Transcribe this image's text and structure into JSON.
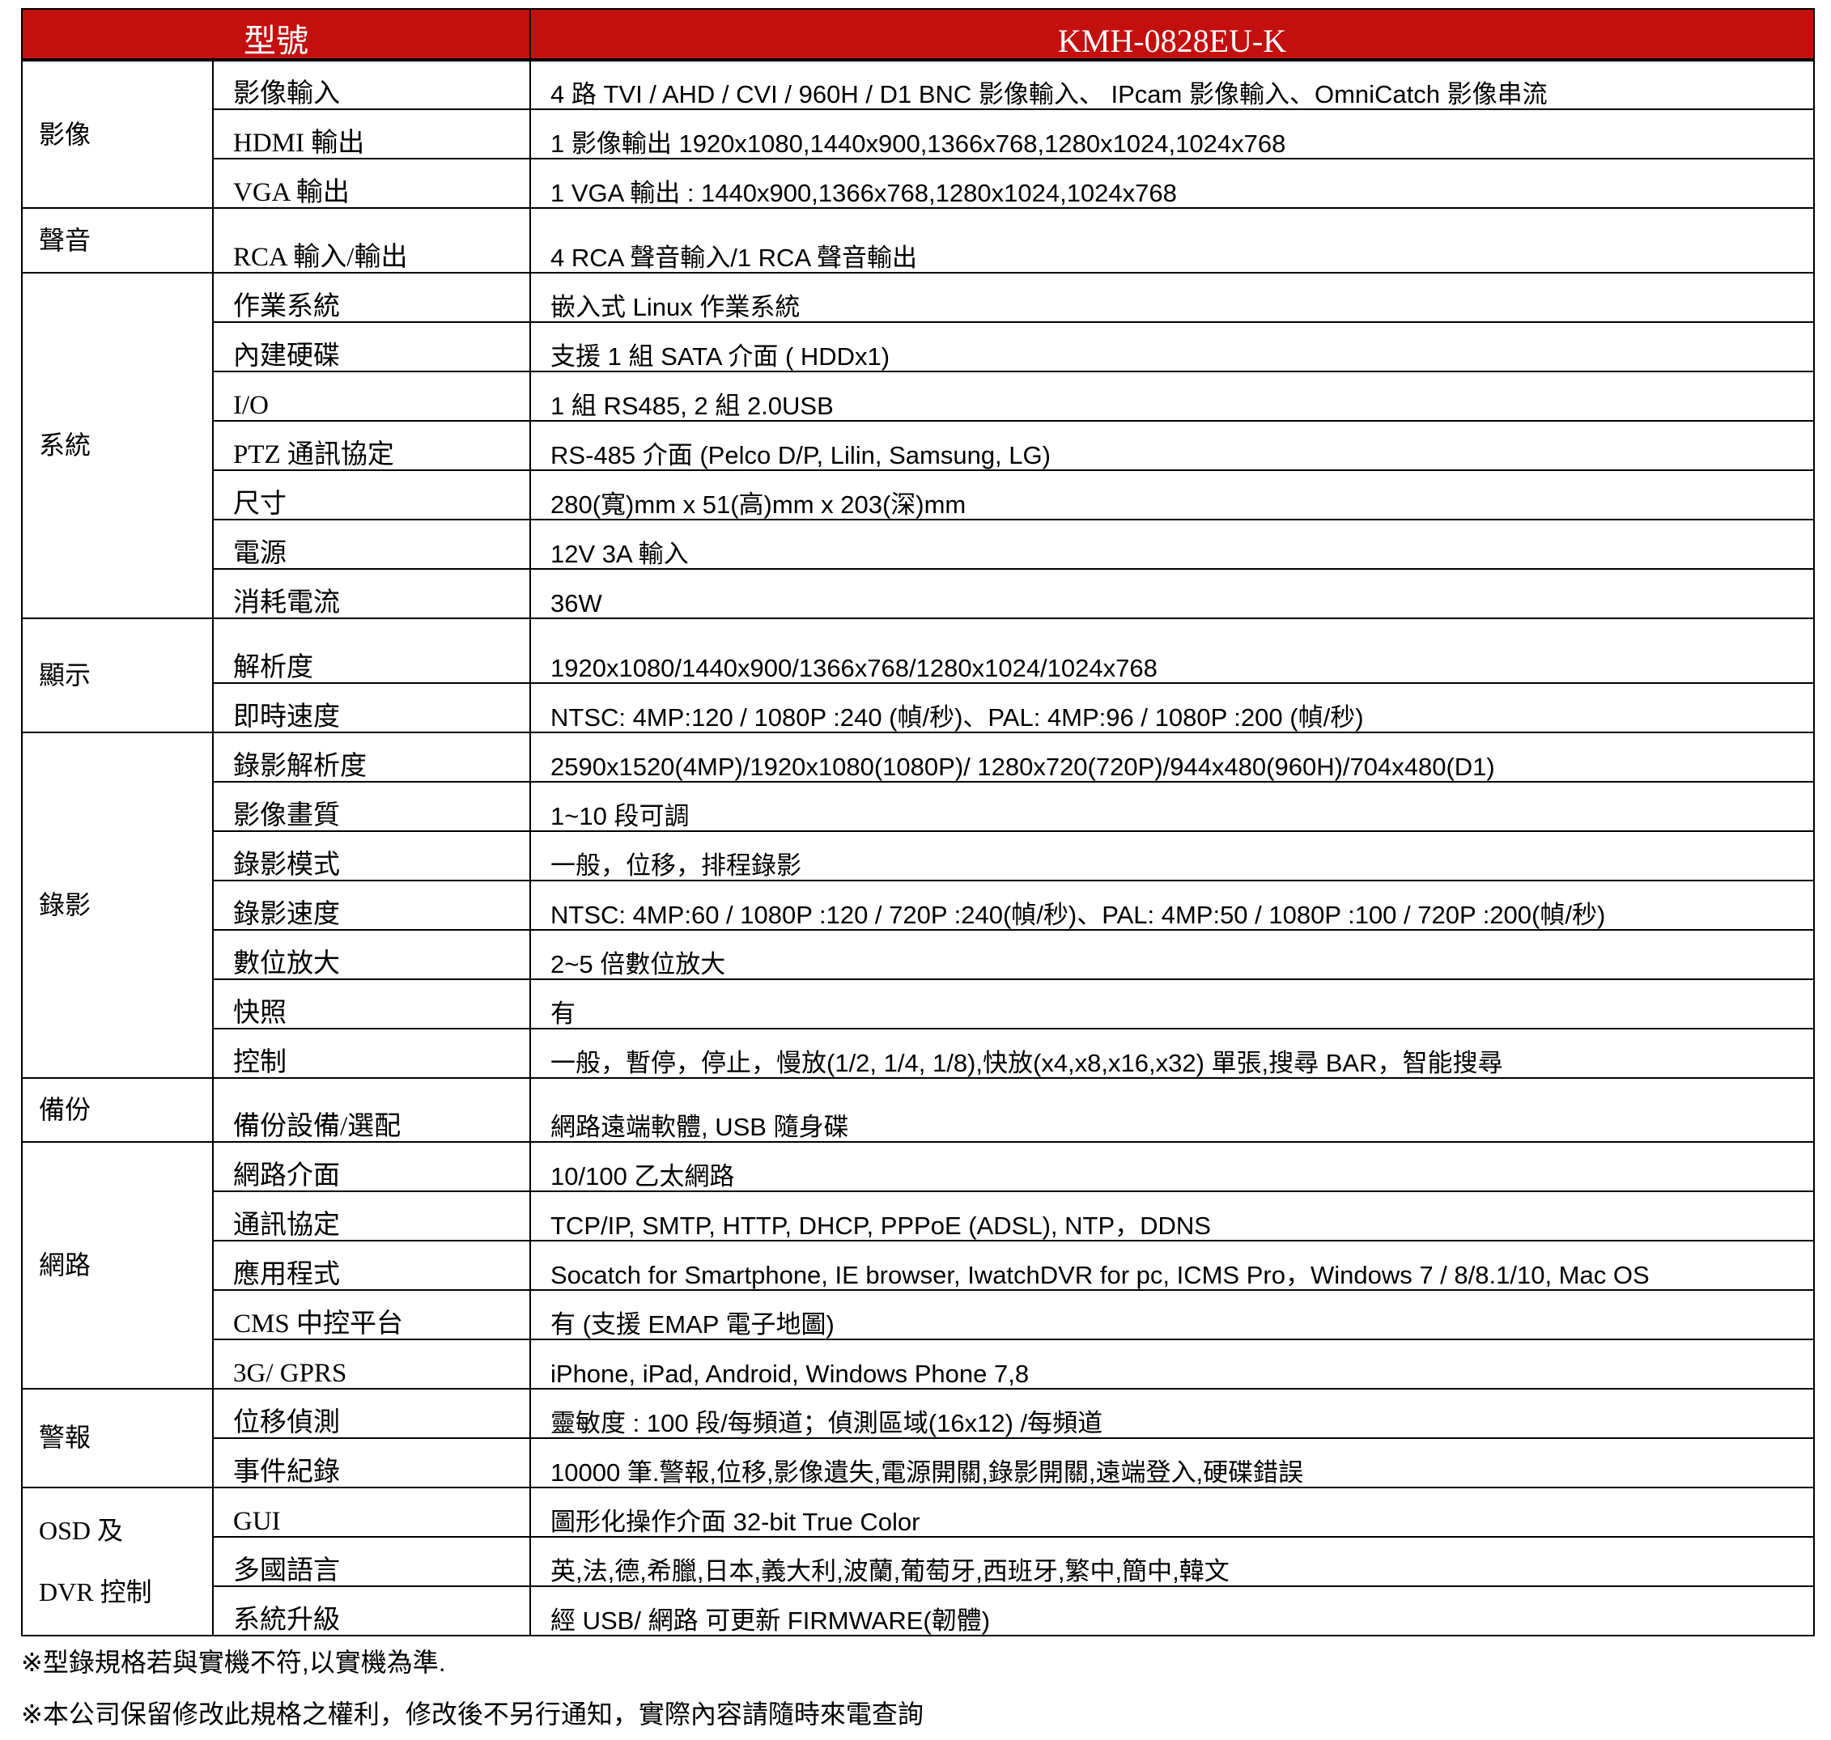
{
  "header": {
    "col1": "型號",
    "col2": "KMH-0828EU-K"
  },
  "groups": [
    {
      "category": [
        "影像"
      ],
      "rows": [
        {
          "feature": "影像輸入",
          "value": "4 路 TVI / AHD / CVI / 960H / D1 BNC 影像輸入、 IPcam 影像輸入、OmniCatch 影像串流"
        },
        {
          "feature": "HDMI 輸出",
          "value": "1 影像輸出 1920x1080,1440x900,1366x768,1280x1024,1024x768"
        },
        {
          "feature": "VGA 輸出",
          "value": "1 VGA  輸出 : 1440x900,1366x768,1280x1024,1024x768"
        }
      ]
    },
    {
      "category": [
        "聲音"
      ],
      "rows": [
        {
          "feature": "RCA 輸入/輸出",
          "value": "4 RCA 聲音輸入/1 RCA  聲音輸出",
          "tall": true
        }
      ]
    },
    {
      "category": [
        "系統"
      ],
      "rows": [
        {
          "feature": "作業系統",
          "value": "嵌入式 Linux  作業系統"
        },
        {
          "feature": "內建硬碟",
          "value": "支援 1 組  SATA 介面  ( HDDx1)"
        },
        {
          "feature": "I/O",
          "value": "1 組 RS485, 2 組 2.0USB"
        },
        {
          "feature": "PTZ 通訊協定",
          "value": "RS-485 介面  (Pelco D/P, Lilin, Samsung, LG)"
        },
        {
          "feature": "尺寸",
          "value": "280(寬)mm x 51(高)mm x 203(深)mm"
        },
        {
          "feature": "電源",
          "value": "12V 3A  輸入"
        },
        {
          "feature": "消耗電流",
          "value": "36W"
        }
      ]
    },
    {
      "category": [
        "顯示"
      ],
      "rows": [
        {
          "feature": "解析度",
          "value": "1920x1080/1440x900/1366x768/1280x1024/1024x768",
          "tall": true
        },
        {
          "feature": "即時速度",
          "value": "NTSC: 4MP:120 / 1080P :240 (幀/秒)、PAL: 4MP:96 / 1080P :200 (幀/秒)"
        }
      ]
    },
    {
      "category": [
        "錄影"
      ],
      "rows": [
        {
          "feature": "錄影解析度",
          "value": "2590x1520(4MP)/1920x1080(1080P)/ 1280x720(720P)/944x480(960H)/704x480(D1)"
        },
        {
          "feature": "影像畫質",
          "value": "1~10 段可調"
        },
        {
          "feature": "錄影模式",
          "value": "一般，位移，排程錄影"
        },
        {
          "feature": "錄影速度",
          "value": "NTSC: 4MP:60 / 1080P :120 / 720P :240(幀/秒)、PAL: 4MP:50 / 1080P :100 / 720P :200(幀/秒)"
        },
        {
          "feature": "數位放大",
          "value": "2~5 倍數位放大"
        },
        {
          "feature": "快照",
          "value": "有"
        },
        {
          "feature": "控制",
          "value": "一般，暫停，停止，慢放(1/2, 1/4, 1/8),快放(x4,x8,x16,x32)  單張,搜尋 BAR，智能搜尋"
        }
      ]
    },
    {
      "category": [
        "備份"
      ],
      "rows": [
        {
          "feature": "備份設備/選配",
          "value": "網路遠端軟體, USB 隨身碟"
        }
      ]
    },
    {
      "category": [
        "網路"
      ],
      "rows": [
        {
          "feature": "網路介面",
          "value": "10/100  乙太網路"
        },
        {
          "feature": "通訊協定",
          "value": "TCP/IP, SMTP, HTTP, DHCP, PPPoE (ADSL), NTP，DDNS"
        },
        {
          "feature": "應用程式",
          "value": "Socatch for Smartphone, IE browser, IwatchDVR for pc, ICMS Pro，Windows 7 / 8/8.1/10, Mac OS"
        },
        {
          "feature": "CMS 中控平台",
          "value": "有  (支援 EMAP 電子地圖)"
        },
        {
          "feature": "3G/ GPRS",
          "value": "iPhone, iPad, Android, Windows Phone 7,8"
        }
      ]
    },
    {
      "category": [
        "警報"
      ],
      "rows": [
        {
          "feature": "位移偵測",
          "value": "靈敏度  : 100 段/每頻道；偵測區域(16x12) /每頻道"
        },
        {
          "feature": "事件紀錄",
          "value": "10000 筆.警報,位移,影像遺失,電源開關,錄影開關,遠端登入,硬碟錯誤"
        }
      ]
    },
    {
      "category": [
        "OSD  及",
        "DVR  控制"
      ],
      "rows": [
        {
          "feature": "GUI",
          "value": "圖形化操作介面 32-bit True Color"
        },
        {
          "feature": "多國語言",
          "value": "英,法,德,希臘,日本,義大利,波蘭,葡萄牙,西班牙,繁中,簡中,韓文"
        },
        {
          "feature": "系統升級",
          "value": "經 USB/  網路  可更新 FIRMWARE(韌體)"
        }
      ]
    }
  ],
  "notes": [
    "※型錄規格若與實機不符,以實機為準.",
    "※本公司保留修改此規格之權利，修改後不另行通知，實際內容請隨時來電查詢"
  ]
}
